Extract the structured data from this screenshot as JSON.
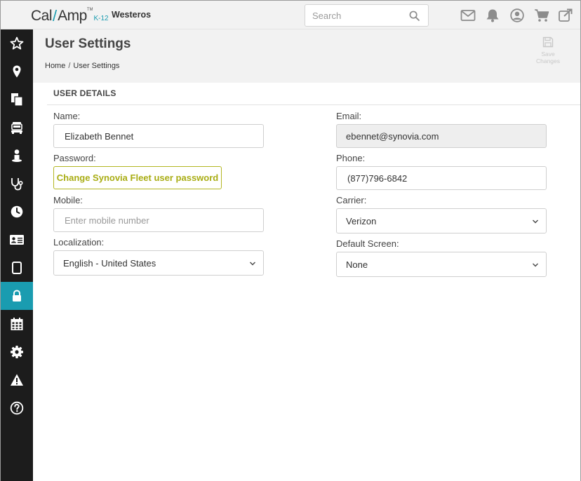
{
  "brand": {
    "logo_cal": "Cal",
    "logo_slash": "/",
    "logo_amp": "Amp",
    "logo_tm": "TM",
    "logo_k12": "K-12",
    "org_name": "Westeros"
  },
  "header": {
    "search_placeholder": "Search",
    "icons": [
      "mail-icon",
      "bell-icon",
      "user-circle-icon",
      "cart-icon",
      "external-link-icon"
    ]
  },
  "sidebar": {
    "items": [
      {
        "icon": "star-icon",
        "active": false
      },
      {
        "icon": "map-pin-icon",
        "active": false
      },
      {
        "icon": "documents-icon",
        "active": false
      },
      {
        "icon": "vehicle-icon",
        "active": false
      },
      {
        "icon": "person-icon",
        "active": false
      },
      {
        "icon": "stethoscope-icon",
        "active": false
      },
      {
        "icon": "clock-icon",
        "active": false
      },
      {
        "icon": "id-card-icon",
        "active": false
      },
      {
        "icon": "tablet-icon",
        "active": false
      },
      {
        "icon": "lock-icon",
        "active": true
      },
      {
        "icon": "calendar-icon",
        "active": false
      },
      {
        "icon": "gear-icon",
        "active": false
      },
      {
        "icon": "warning-icon",
        "active": false
      },
      {
        "icon": "help-icon",
        "active": false
      }
    ],
    "active_color": "#1a9cb0"
  },
  "page": {
    "title": "User Settings",
    "breadcrumb": {
      "home": "Home",
      "separator": "/",
      "current": "User Settings"
    },
    "save": {
      "line1": "Save",
      "line2": "Changes"
    }
  },
  "user_details": {
    "section_title": "USER DETAILS",
    "name": {
      "label": "Name:",
      "value": "Elizabeth Bennet"
    },
    "email": {
      "label": "Email:",
      "value": "ebennet@synovia.com"
    },
    "password": {
      "label": "Password:",
      "button": "Change Synovia Fleet user password"
    },
    "phone": {
      "label": "Phone:",
      "value": "(877)796-6842"
    },
    "mobile": {
      "label": "Mobile:",
      "value": "",
      "placeholder": "Enter mobile number"
    },
    "carrier": {
      "label": "Carrier:",
      "value": "Verizon"
    },
    "localization": {
      "label": "Localization:",
      "value": "English - United States"
    },
    "default_screen": {
      "label": "Default Screen:",
      "value": "None"
    }
  },
  "colors": {
    "accent": "#1a9cb0",
    "password_button": "#a9ad14",
    "sidebar_bg": "#1c1c1c",
    "header_bg": "#f2f2f2"
  }
}
